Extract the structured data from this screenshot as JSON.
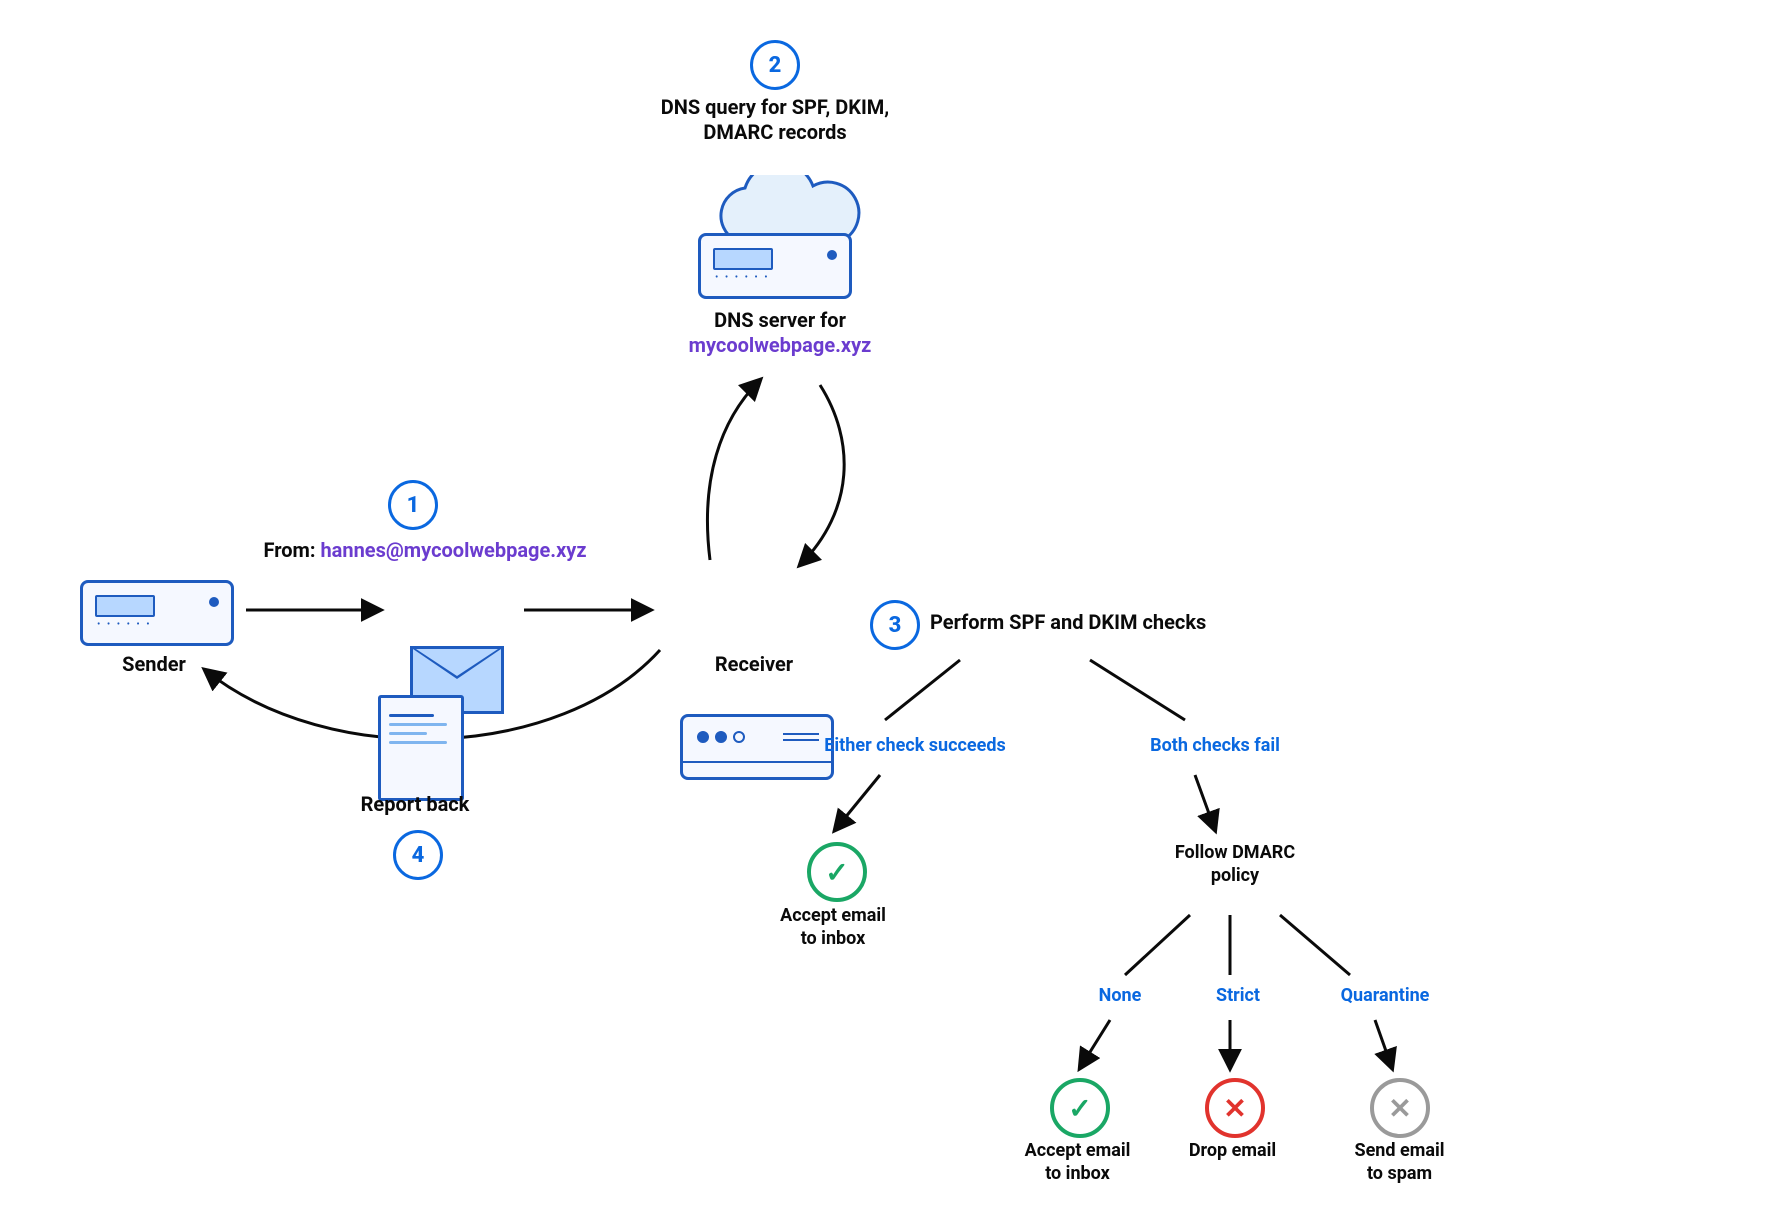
{
  "steps": {
    "s1": {
      "num": "1",
      "prefix": "From: ",
      "email": "hannes@mycoolwebpage.xyz"
    },
    "s2": {
      "num": "2",
      "text": "DNS query for SPF, DKIM,\nDMARC records"
    },
    "s3": {
      "num": "3",
      "text": "Perform SPF and DKIM checks"
    },
    "s4": {
      "num": "4",
      "text": "Report back"
    }
  },
  "nodes": {
    "sender": "Sender",
    "receiver": "Receiver",
    "dns_server_prefix": "DNS server for",
    "dns_domain": "mycoolwebpage.xyz"
  },
  "branches": {
    "succeed": "Either check succeeds",
    "fail": "Both checks fail",
    "dmarc": "Follow DMARC\npolicy",
    "none": "None",
    "strict": "Strict",
    "quarantine": "Quarantine"
  },
  "outcomes": {
    "accept": "Accept email\nto inbox",
    "drop": "Drop email",
    "spam": "Send email\nto spam"
  },
  "glyphs": {
    "check": "✓",
    "cross": "✕"
  }
}
